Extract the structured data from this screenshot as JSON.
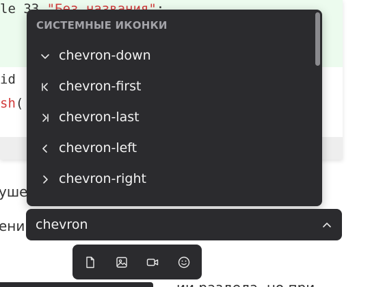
{
  "code": {
    "line1_prefix": "le 33 ",
    "line1_string": "\"Без названия\"",
    "line1_suffix": ";",
    "line2": "id",
    "line3_fn": "sh",
    "line3_paren": "("
  },
  "background_text": {
    "left_fragment_1": "уше",
    "left_fragment_2": "ений",
    "bottom_fragment": "ии раздела, но при"
  },
  "dropdown": {
    "header": "СИСТЕМНЫЕ ИКОНКИ",
    "items": [
      {
        "label": "chevron-down",
        "icon": "chevron-down-icon"
      },
      {
        "label": "chevron-first",
        "icon": "chevron-first-icon"
      },
      {
        "label": "chevron-last",
        "icon": "chevron-last-icon"
      },
      {
        "label": "chevron-left",
        "icon": "chevron-left-icon"
      },
      {
        "label": "chevron-right",
        "icon": "chevron-right-icon"
      }
    ]
  },
  "search": {
    "value": "chevron"
  },
  "toolbar": {
    "buttons": [
      "file-icon",
      "image-icon",
      "video-icon",
      "emoji-icon"
    ]
  },
  "colors": {
    "panel_bg": "#2b2b2e",
    "item_text": "#f2f2f2",
    "header_text": "#a3a3a8",
    "code_highlight": "#ecfbee",
    "code_string": "#d23b3b"
  }
}
